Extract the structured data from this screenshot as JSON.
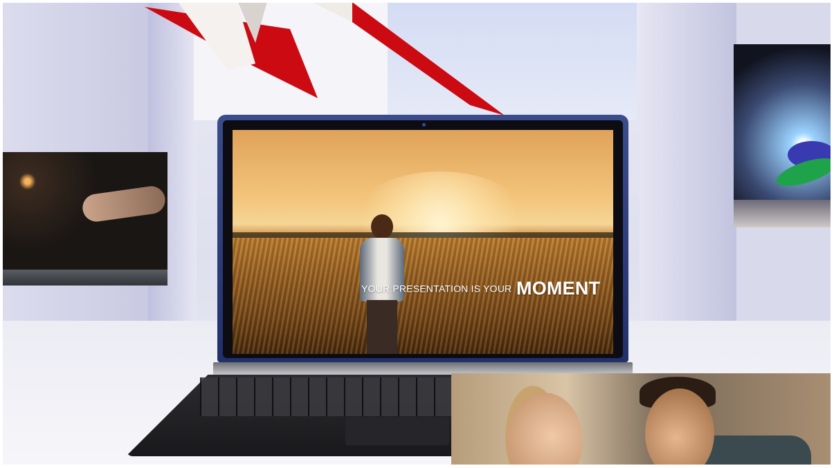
{
  "slide_caption": {
    "lead": "YOUR PRESENTATION IS YOUR",
    "emphasis": "MOMENT"
  },
  "colors": {
    "background": "#e6e6f2",
    "plane_accent": "#cc0a12",
    "caption_text": "#ffffff",
    "laptop_lid": "#2d3d7c"
  }
}
